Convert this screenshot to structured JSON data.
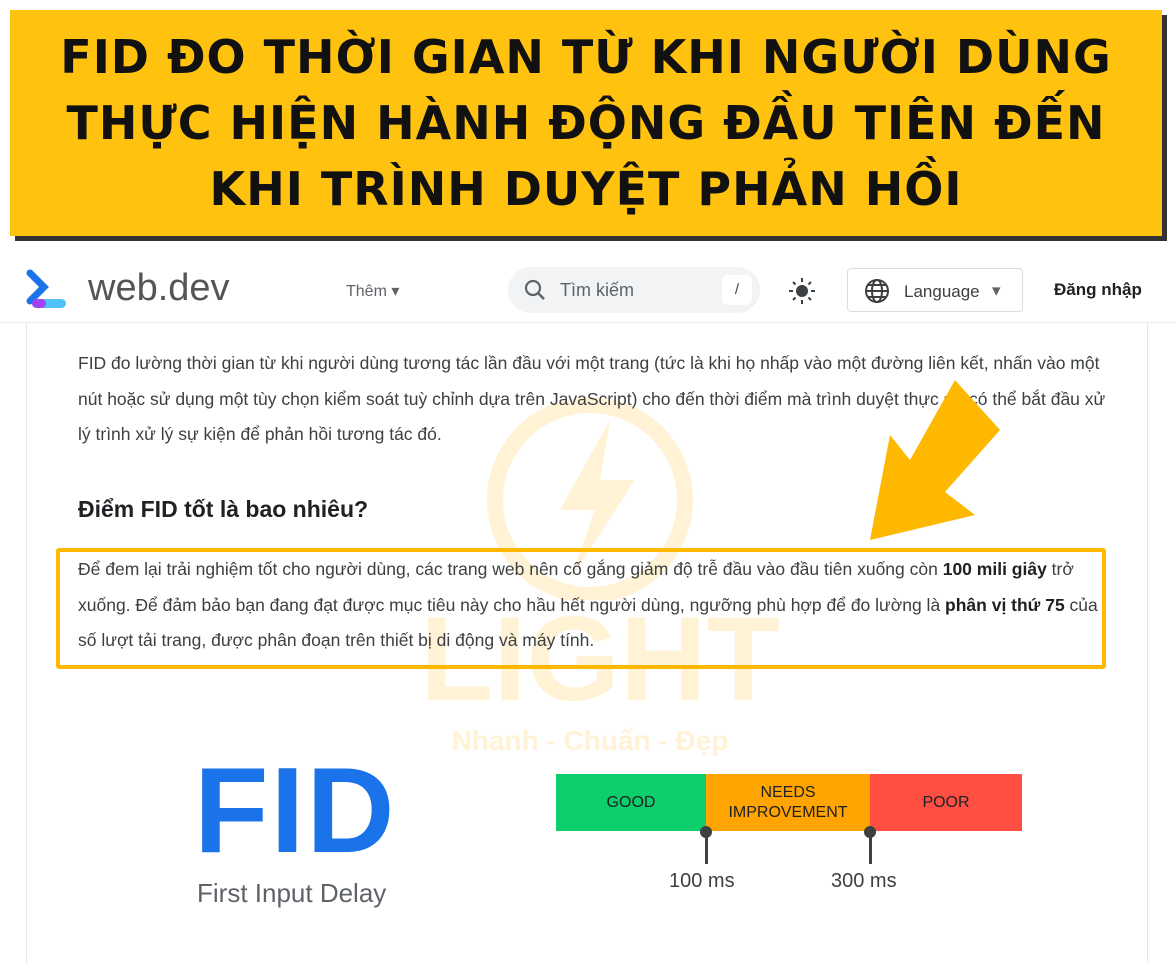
{
  "banner": {
    "lines": [
      "FID ĐO THỜI GIAN TỪ KHI NGƯỜI DÙNG",
      "THỰC HIỆN HÀNH ĐỘNG ĐẦU TIÊN ĐẾN",
      "KHI TRÌNH DUYỆT PHẢN HỒI"
    ]
  },
  "header": {
    "brand": "web.dev",
    "more": "Thêm",
    "search_placeholder": "Tìm kiếm",
    "search_shortcut": "/",
    "language": "Language",
    "signin": "Đăng nhập"
  },
  "content": {
    "intro": "FID đo lường thời gian từ khi người dùng tương tác lần đầu với một trang (tức là khi họ nhấp vào một đường liên kết, nhấn vào một nút hoặc sử dụng một tùy chọn kiểm soát tuỳ chỉnh dựa trên JavaScript) cho đến thời điểm mà trình duyệt thực sự có thể bắt đầu xử lý trình xử lý sự kiện để phản hồi tương tác đó.",
    "heading": "Điểm FID tốt là bao nhiêu?",
    "highlight": {
      "t1": "Để đem lại trải nghiệm tốt cho người dùng, các trang web nên cố gắng giảm độ trễ đầu vào đầu tiên xuống còn ",
      "b1": "100 mili giây",
      "t2": " trở xuống. Để đảm bảo bạn đang đạt được mục tiêu này cho hầu hết người dùng, ngưỡng phù hợp để đo lường là ",
      "b2": "phân vị thứ 75",
      "t3": " của số lượt tải trang, được phân đoạn trên thiết bị di động và máy tính."
    }
  },
  "watermark": {
    "big": "LIGHT",
    "sub": "Nhanh - Chuẩn - Đẹp"
  },
  "fid": {
    "title": "FID",
    "subtitle": "First Input Delay"
  },
  "scale": {
    "segments": [
      {
        "label": "GOOD",
        "color": "#0CCE6B"
      },
      {
        "label": "NEEDS IMPROVEMENT",
        "color": "#FFA400"
      },
      {
        "label": "POOR",
        "color": "#FF4E42"
      }
    ],
    "thresholds": [
      "100 ms",
      "300 ms"
    ]
  },
  "colors": {
    "banner": "#FFC20E",
    "highlight_border": "#FFB800",
    "arrow": "#FFB800",
    "fid_blue": "#1a73e8"
  }
}
